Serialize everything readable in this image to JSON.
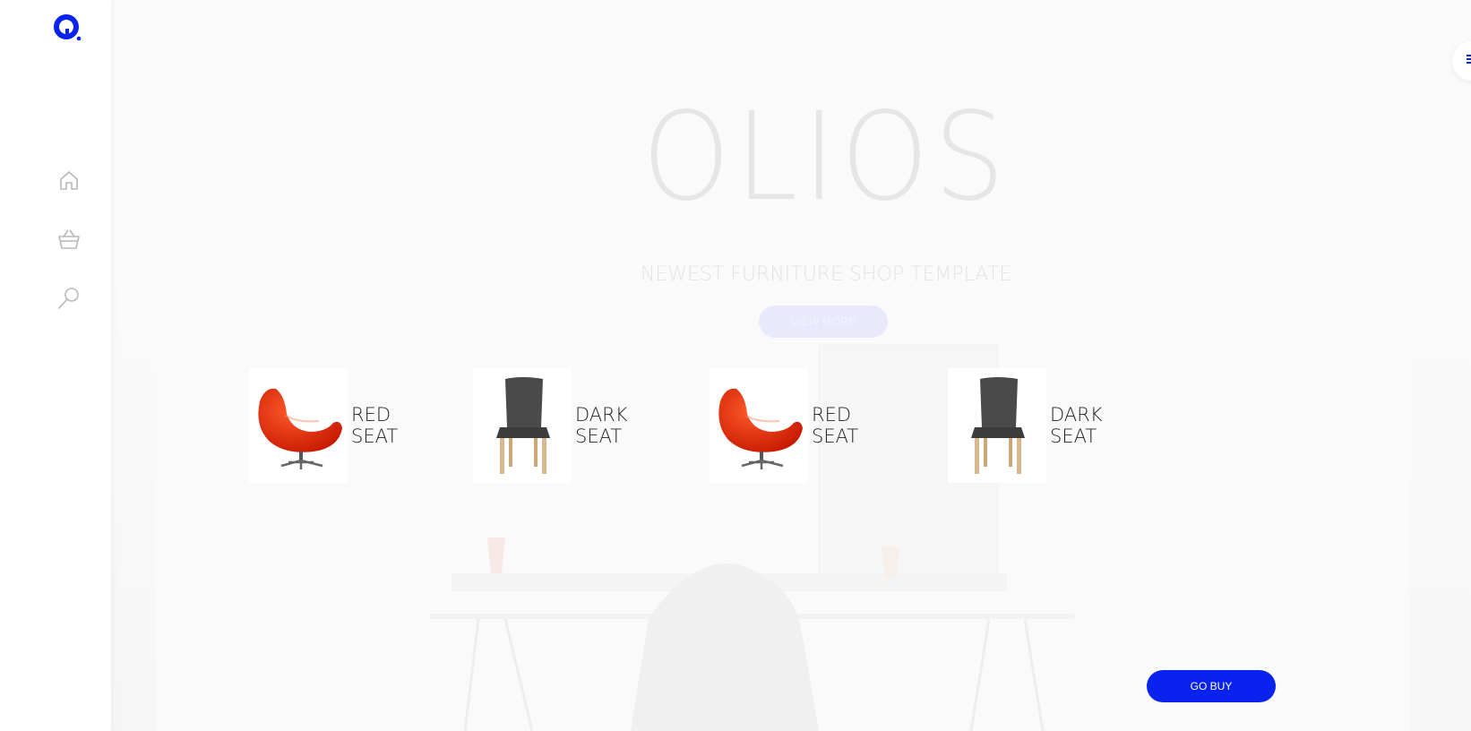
{
  "brand": {
    "logo_icon": "olios-logo-icon",
    "accent": "#0a22ee"
  },
  "sidebar": {
    "items": [
      {
        "icon": "home-icon"
      },
      {
        "icon": "basket-icon"
      },
      {
        "icon": "search-icon"
      }
    ]
  },
  "header": {
    "menu_icon": "hamburger-menu-icon"
  },
  "hero": {
    "title": "OLIOS",
    "subtitle": "NEWEST FURNITURE SHOP TEMPLATE",
    "view_more_label": "VIEW MORE"
  },
  "products": [
    {
      "name": "RED SEAT",
      "image": "red-egg-chair"
    },
    {
      "name": "DARK SEAT",
      "image": "dark-dining-chair"
    },
    {
      "name": "RED SEAT",
      "image": "red-egg-chair"
    },
    {
      "name": "DARK SEAT",
      "image": "dark-dining-chair"
    }
  ],
  "cta": {
    "go_buy_label": "GO BUY"
  }
}
